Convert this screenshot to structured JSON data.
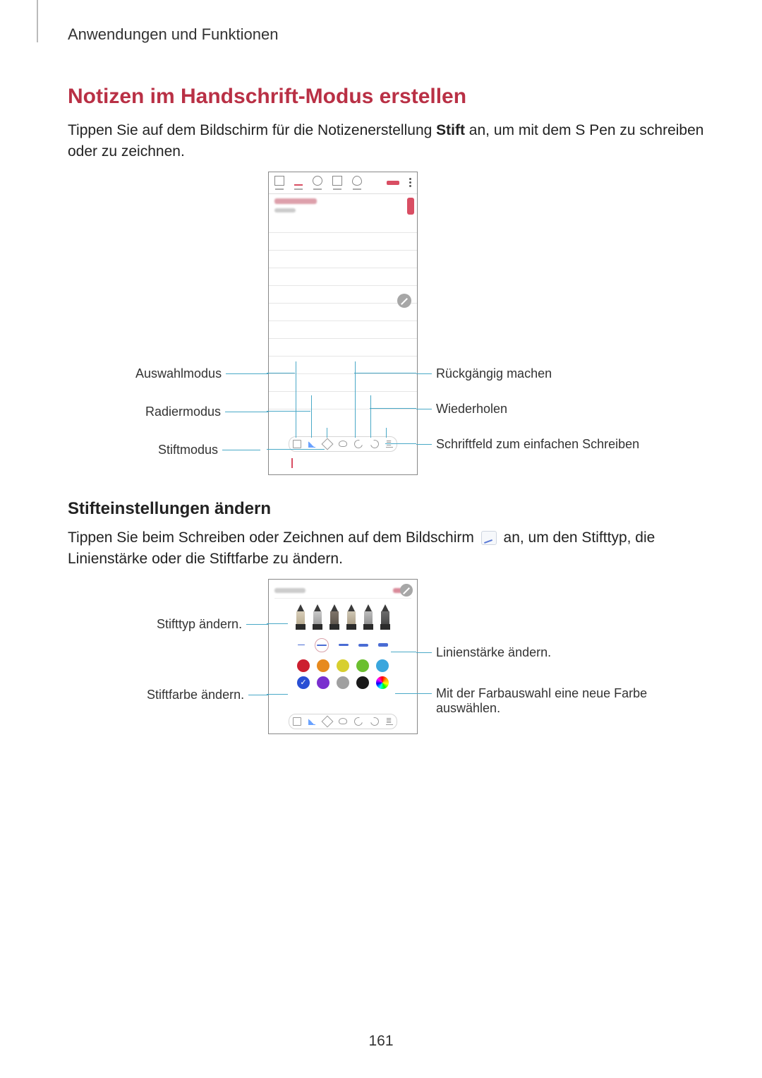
{
  "header": {
    "breadcrumb": "Anwendungen und Funktionen"
  },
  "h1": "Notizen im Handschrift-Modus erstellen",
  "p1_a": "Tippen Sie auf dem Bildschirm für die Notizenerstellung ",
  "p1_b": "Stift",
  "p1_c": " an, um mit dem S Pen zu schreiben oder zu zeichnen.",
  "fig1": {
    "left": {
      "select": "Auswahlmodus",
      "erase": "Radiermodus",
      "pen": "Stiftmodus"
    },
    "right": {
      "undo": "Rückgängig machen",
      "redo": "Wiederholen",
      "textfield": "Schriftfeld zum einfachen Schreiben"
    }
  },
  "h2": "Stifteinstellungen ändern",
  "p2_a": "Tippen Sie beim Schreiben oder Zeichnen auf dem Bildschirm ",
  "p2_b": " an, um den Stifttyp, die Linienstärke oder die Stiftfarbe zu ändern.",
  "fig2": {
    "left": {
      "type": "Stifttyp ändern.",
      "color": "Stiftfarbe ändern."
    },
    "right": {
      "thickness": "Linienstärke ändern.",
      "picker": "Mit der Farbauswahl eine neue Farbe auswählen."
    }
  },
  "page_number": "161"
}
